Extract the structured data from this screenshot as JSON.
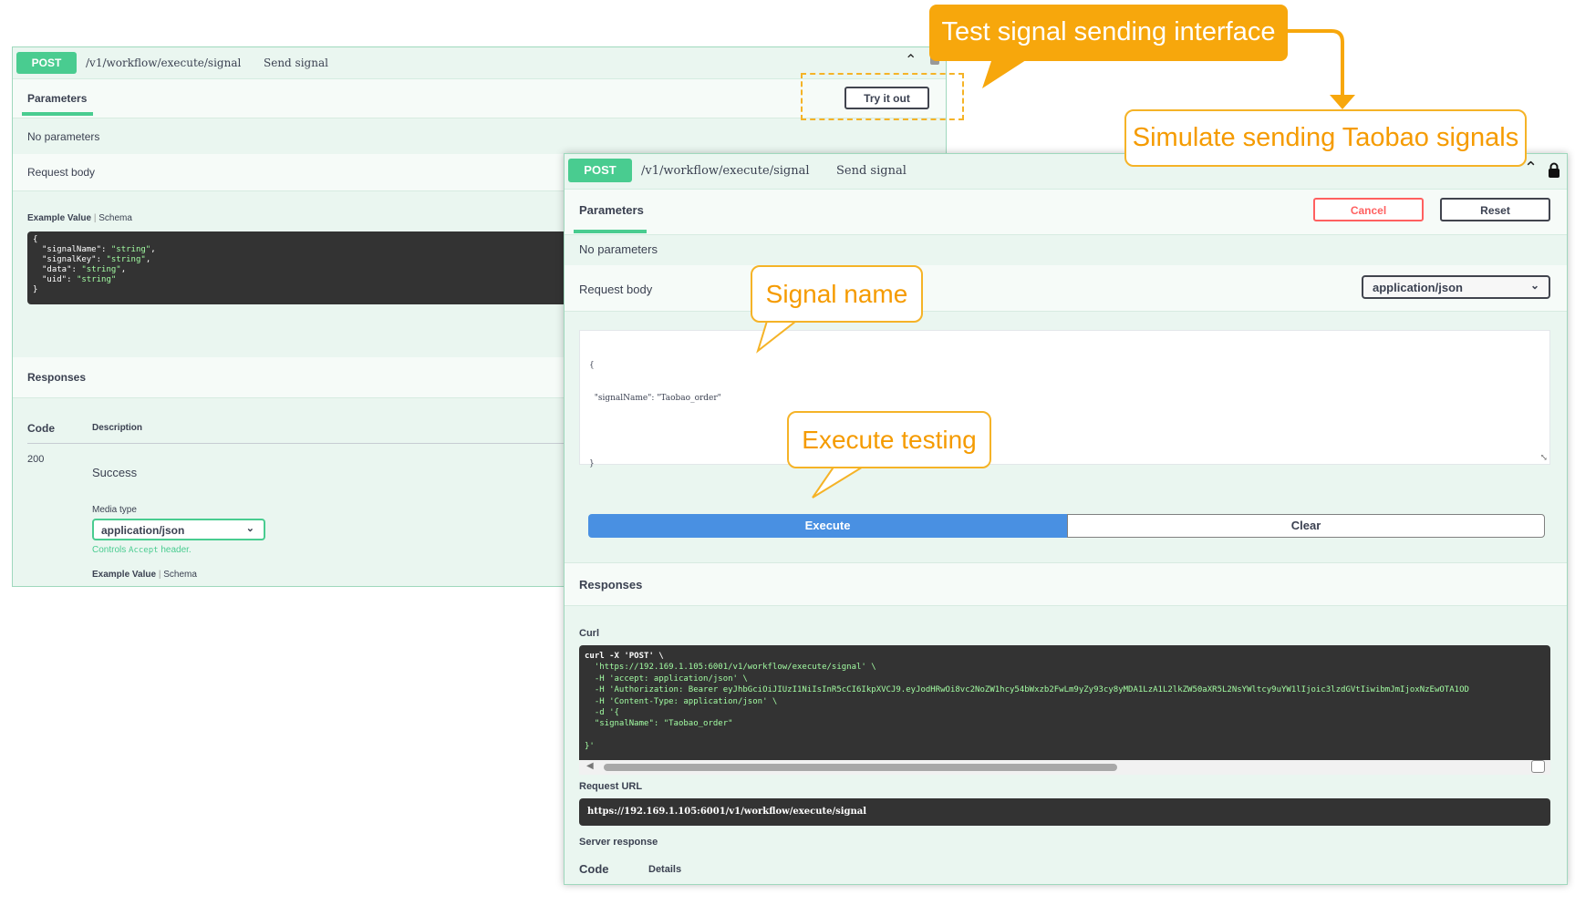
{
  "back_panel": {
    "method": "POST",
    "path": "/v1/workflow/execute/signal",
    "summary": "Send signal",
    "parameters_tab": "Parameters",
    "try_it_out": "Try it out",
    "no_parameters": "No parameters",
    "request_body": "Request body",
    "example_value_tab": "Example Value",
    "schema_tab": "Schema",
    "example_json": {
      "open": "{",
      "lines": [
        {
          "key": "\"signalName\"",
          "value": "\"string\"",
          "sep": ","
        },
        {
          "key": "\"signalKey\"",
          "value": "\"string\"",
          "sep": ","
        },
        {
          "key": "\"data\"",
          "value": "\"string\"",
          "sep": ","
        },
        {
          "key": "\"uid\"",
          "value": "\"string\"",
          "sep": ""
        }
      ],
      "close": "}"
    },
    "responses_title": "Responses",
    "code_header": "Code",
    "description_header": "Description",
    "response_code": "200",
    "response_description": "Success",
    "media_type_label": "Media type",
    "media_type_value": "application/json",
    "controls_pre": "Controls",
    "controls_code": "Accept",
    "controls_post": "header.",
    "example_value_tab_2": "Example Value",
    "schema_tab_2": "Schema"
  },
  "front_panel": {
    "method": "POST",
    "path": "/v1/workflow/execute/signal",
    "summary": "Send signal",
    "parameters_tab": "Parameters",
    "cancel": "Cancel",
    "reset": "Reset",
    "no_parameters": "No parameters",
    "request_body": "Request body",
    "content_type": "application/json",
    "body_lines": [
      "{",
      "  \"signalName\": \"Taobao_order\"",
      "",
      "}"
    ],
    "execute": "Execute",
    "clear": "Clear",
    "responses_title": "Responses",
    "curl_label": "Curl",
    "curl_lines": [
      "curl -X 'POST' \\",
      "  'https://192.169.1.105:6001/v1/workflow/execute/signal' \\",
      "  -H 'accept: application/json' \\",
      "  -H 'Authorization: Bearer eyJhbGciOiJIUzI1NiIsInR5cCI6IkpXVCJ9.eyJodHRwOi8vc2NoZW1hcy54bWxzb2FwLm9yZy93cy8yMDA1LzA1L2lkZW50aXR5L2NsYWltcy9uYW1lIjoic3lzdGVtIiwibmJmIjoxNzEwOTA1OD",
      "  -H 'Content-Type: application/json' \\",
      "  -d '{",
      "  \"signalName\": \"Taobao_order\"",
      "",
      "}'"
    ],
    "request_url_label": "Request URL",
    "request_url": "https://192.169.1.105:6001/v1/workflow/execute/signal",
    "server_response_label": "Server response",
    "code_header": "Code",
    "details_header": "Details"
  },
  "callouts": {
    "test_interface": "Test signal sending interface",
    "simulate": "Simulate sending Taobao signals",
    "signal_name": "Signal name",
    "execute_testing": "Execute testing"
  },
  "colors": {
    "post_green": "#49cc90",
    "execute_blue": "#4990e2",
    "cancel_red": "#ff6060",
    "callout_orange": "#f7a70c",
    "code_bg": "#333333"
  }
}
